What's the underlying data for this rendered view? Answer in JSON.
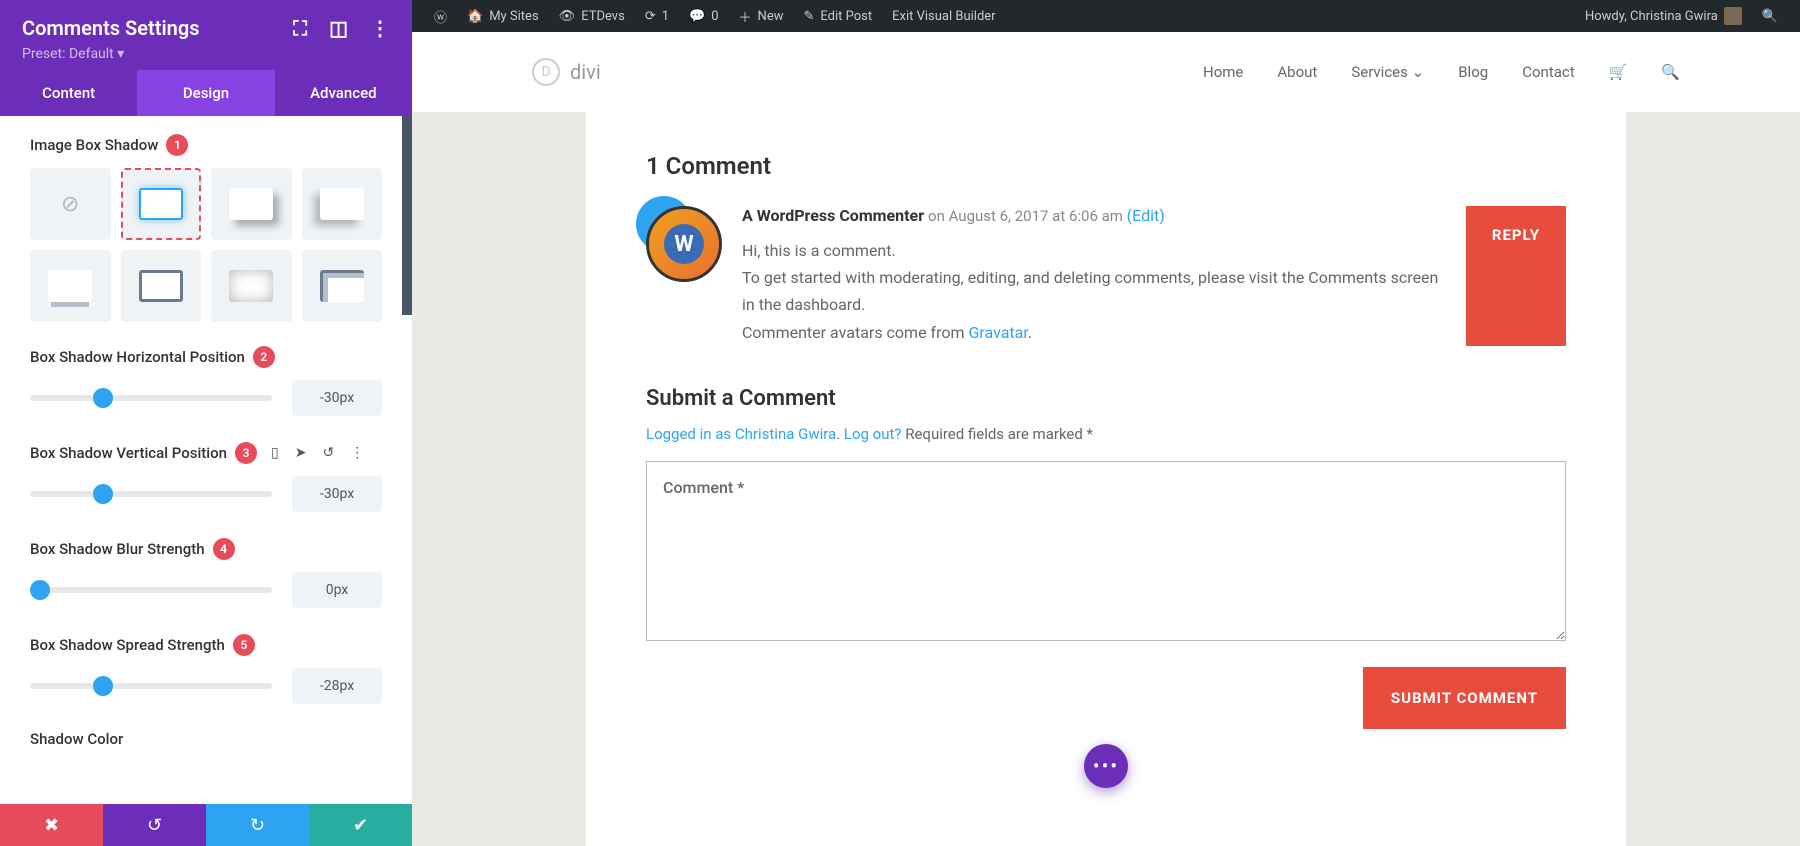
{
  "panel": {
    "title": "Comments Settings",
    "preset": "Preset: Default ▾",
    "tabs": {
      "content": "Content",
      "design": "Design",
      "advanced": "Advanced"
    },
    "options": {
      "image_box_shadow": {
        "label": "Image Box Shadow",
        "badge": "1"
      },
      "horiz": {
        "label": "Box Shadow Horizontal Position",
        "badge": "2",
        "value": "-30px",
        "pos": 30
      },
      "vert": {
        "label": "Box Shadow Vertical Position",
        "badge": "3",
        "value": "-30px",
        "pos": 30
      },
      "blur": {
        "label": "Box Shadow Blur Strength",
        "badge": "4",
        "value": "0px",
        "pos": 4
      },
      "spread": {
        "label": "Box Shadow Spread Strength",
        "badge": "5",
        "value": "-28px",
        "pos": 30
      },
      "shadow_color": {
        "label": "Shadow Color"
      }
    }
  },
  "adminbar": {
    "mysites": "My Sites",
    "site": "ETDevs",
    "updates": "1",
    "comments": "0",
    "new": "New",
    "edit": "Edit Post",
    "exit": "Exit Visual Builder",
    "howdy": "Howdy, Christina Gwira"
  },
  "nav": {
    "home": "Home",
    "about": "About",
    "services": "Services",
    "blog": "Blog",
    "contact": "Contact",
    "logo": "divi"
  },
  "comments": {
    "heading": "1 Comment",
    "author": "A WordPress Commenter",
    "date": " on August 6, 2017 at 6:06 am ",
    "edit": "(Edit)",
    "line1": "Hi, this is a comment.",
    "line2a": "To get started with moderating, editing, and deleting comments, please visit the Comments screen in the dashboard.",
    "line3a": "Commenter avatars come from ",
    "gravatar": "Gravatar",
    "period": ".",
    "reply": "REPLY"
  },
  "form": {
    "title": "Submit a Comment",
    "logged": "Logged in as Christina Gwira",
    "logout": "Log out?",
    "required": " Required fields are marked *",
    "placeholder": "Comment *",
    "submit": "SUBMIT COMMENT",
    "sep": ". "
  }
}
